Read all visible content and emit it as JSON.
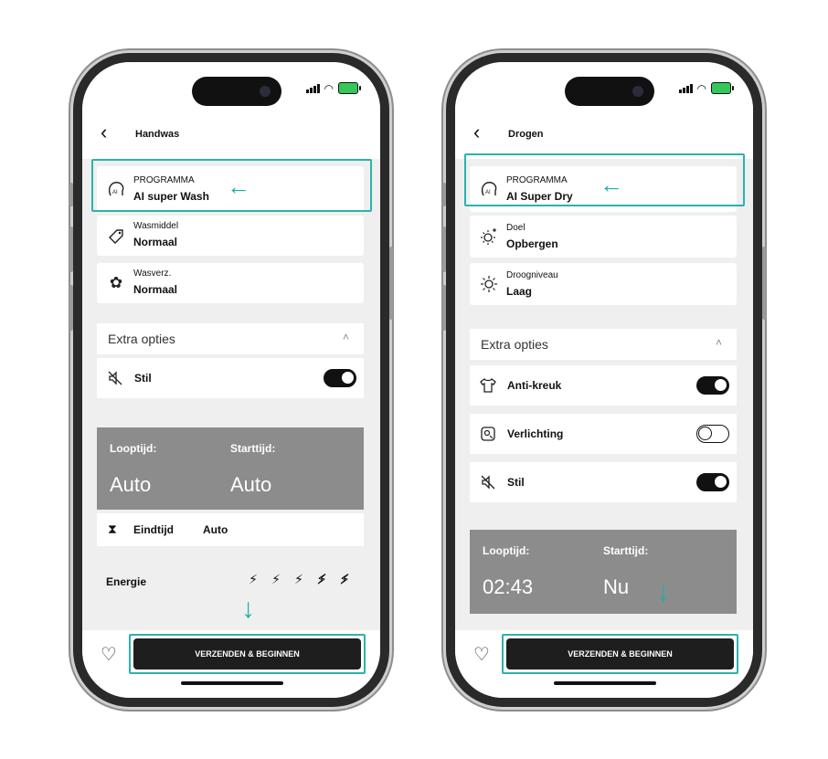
{
  "left_phone": {
    "title": "Handwas",
    "program": {
      "label": "PROGRAMMA",
      "value": "AI super Wash",
      "icon": "ai-program-icon"
    },
    "detergent": {
      "label": "Wasmiddel",
      "value": "Normaal",
      "icon": "detergent-tag-icon"
    },
    "softener": {
      "label": "Wasverz.",
      "value": "Normaal",
      "icon": "flower-icon"
    },
    "extra": {
      "label": "Extra opties",
      "chevron": "˄"
    },
    "options": [
      {
        "label": "Stil",
        "on": true,
        "icon": "mute-icon"
      }
    ],
    "time": {
      "run_label": "Looptijd:",
      "run_value": "Auto",
      "start_label": "Starttijd:",
      "start_value": "Auto"
    },
    "end": {
      "label": "Eindtijd",
      "value": "Auto",
      "icon": "hourglass-icon"
    },
    "energy": {
      "label": "Energie",
      "level": 3,
      "max": 5
    },
    "send_label": "VERZENDEN & BEGINNEN"
  },
  "right_phone": {
    "title": "Drogen",
    "program": {
      "label": "PROGRAMMA",
      "value": "AI Super Dry",
      "icon": "ai-program-icon"
    },
    "goal": {
      "label": "Doel",
      "value": "Opbergen",
      "icon": "sun-plus-icon"
    },
    "dry_level": {
      "label": "Droogniveau",
      "value": "Laag",
      "icon": "sun-icon"
    },
    "extra": {
      "label": "Extra opties",
      "chevron": "˄"
    },
    "options": [
      {
        "label": "Anti-kreuk",
        "on": true,
        "icon": "shirt-icon"
      },
      {
        "label": "Verlichting",
        "on": false,
        "icon": "light-icon"
      },
      {
        "label": "Stil",
        "on": true,
        "icon": "mute-icon"
      }
    ],
    "time": {
      "run_label": "Looptijd:",
      "run_value": "02:43",
      "start_label": "Starttijd:",
      "start_value": "Nu"
    },
    "send_label": "VERZENDEN & BEGINNEN"
  },
  "colors": {
    "accent": "#2ab3ad",
    "button": "#1e1e1e",
    "timebox": "#8c8c8c"
  }
}
